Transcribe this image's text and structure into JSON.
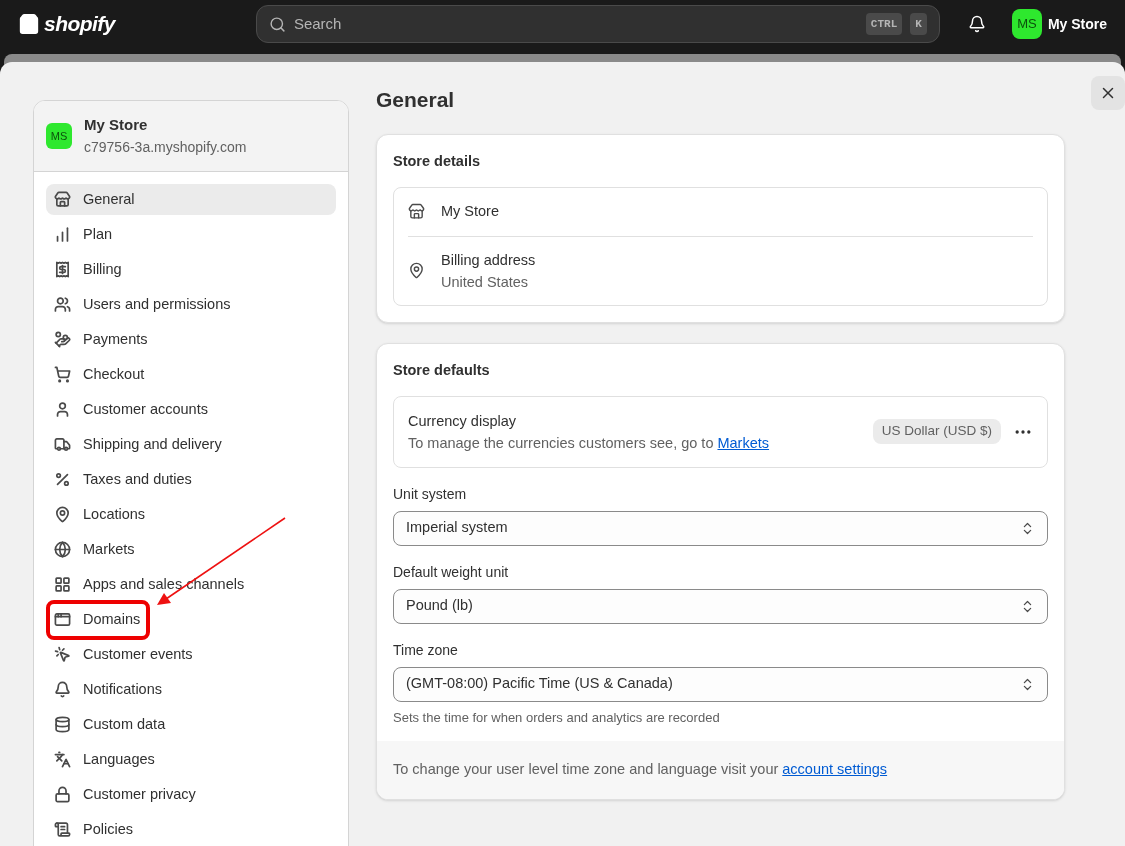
{
  "topbar": {
    "logo_text": "shopify",
    "search": {
      "placeholder": "Search",
      "shortcut": [
        "CTRL",
        "K"
      ]
    },
    "account": {
      "initials": "MS",
      "name": "My Store"
    }
  },
  "sidebar": {
    "store": {
      "initials": "MS",
      "name": "My Store",
      "domain": "c79756-3a.myshopify.com"
    },
    "items": [
      {
        "label": "General",
        "selected": true,
        "highlighted": false
      },
      {
        "label": "Plan",
        "selected": false,
        "highlighted": false
      },
      {
        "label": "Billing",
        "selected": false,
        "highlighted": false
      },
      {
        "label": "Users and permissions",
        "selected": false,
        "highlighted": false
      },
      {
        "label": "Payments",
        "selected": false,
        "highlighted": false
      },
      {
        "label": "Checkout",
        "selected": false,
        "highlighted": false
      },
      {
        "label": "Customer accounts",
        "selected": false,
        "highlighted": false
      },
      {
        "label": "Shipping and delivery",
        "selected": false,
        "highlighted": false
      },
      {
        "label": "Taxes and duties",
        "selected": false,
        "highlighted": false
      },
      {
        "label": "Locations",
        "selected": false,
        "highlighted": false
      },
      {
        "label": "Markets",
        "selected": false,
        "highlighted": false
      },
      {
        "label": "Apps and sales channels",
        "selected": false,
        "highlighted": false
      },
      {
        "label": "Domains",
        "selected": false,
        "highlighted": true
      },
      {
        "label": "Customer events",
        "selected": false,
        "highlighted": false
      },
      {
        "label": "Notifications",
        "selected": false,
        "highlighted": false
      },
      {
        "label": "Custom data",
        "selected": false,
        "highlighted": false
      },
      {
        "label": "Languages",
        "selected": false,
        "highlighted": false
      },
      {
        "label": "Customer privacy",
        "selected": false,
        "highlighted": false
      },
      {
        "label": "Policies",
        "selected": false,
        "highlighted": false
      }
    ]
  },
  "main": {
    "title": "General",
    "store_details": {
      "title": "Store details",
      "rows": [
        {
          "kind": "store",
          "text": "My Store"
        },
        {
          "kind": "address",
          "label": "Billing address",
          "value": "United States"
        }
      ]
    },
    "store_defaults": {
      "title": "Store defaults",
      "currency": {
        "label": "Currency display",
        "description": "To manage the currencies customers see, go to",
        "link": "Markets",
        "badge": "US Dollar (USD $)"
      },
      "selects": [
        {
          "label": "Unit system",
          "value": "Imperial system"
        },
        {
          "label": "Default weight unit",
          "value": "Pound (lb)"
        },
        {
          "label": "Time zone",
          "value": "(GMT-08:00) Pacific Time (US & Canada)",
          "help": "Sets the time for when orders and analytics are recorded"
        }
      ],
      "footer": {
        "text": "To change your user level time zone and language visit your",
        "link": "account settings"
      }
    }
  }
}
